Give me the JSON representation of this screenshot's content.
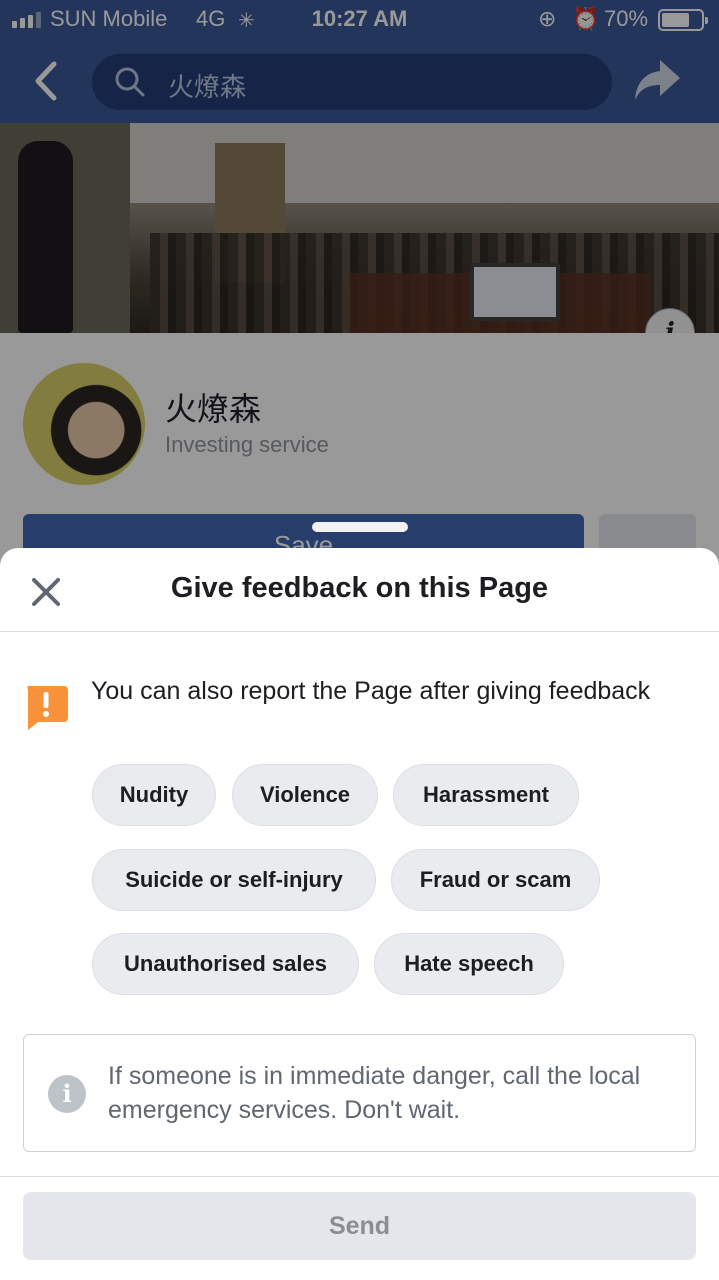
{
  "status_bar": {
    "carrier": "SUN Mobile",
    "network": "4G",
    "time": "10:27 AM",
    "battery_percent": "70%",
    "battery_level": 0.7,
    "icons": [
      "signal-icon",
      "loading-spinner-icon",
      "rotation-lock-icon",
      "alarm-icon",
      "battery-icon"
    ]
  },
  "nav": {
    "search_text": "火燎森",
    "back_icon": "back-chevron-icon",
    "share_icon": "share-icon"
  },
  "page": {
    "name": "火燎森",
    "category": "Investing service",
    "save_label": "Save",
    "more_label": "..."
  },
  "sheet": {
    "title": "Give feedback on this Page",
    "report_note": "You can also report the Page after giving feedback",
    "chips": [
      "Nudity",
      "Violence",
      "Harassment",
      "Suicide or self-injury",
      "Fraud or scam",
      "Unauthorised sales",
      "Hate speech"
    ],
    "notice": "If someone is in immediate danger, call the local emergency services. Don't wait.",
    "send_label": "Send"
  },
  "colors": {
    "brand_blue": "#3b5998",
    "warning_orange": "#f7923a",
    "chip_bg": "#e9ebee",
    "disabled_button": "#e4e6eb"
  }
}
